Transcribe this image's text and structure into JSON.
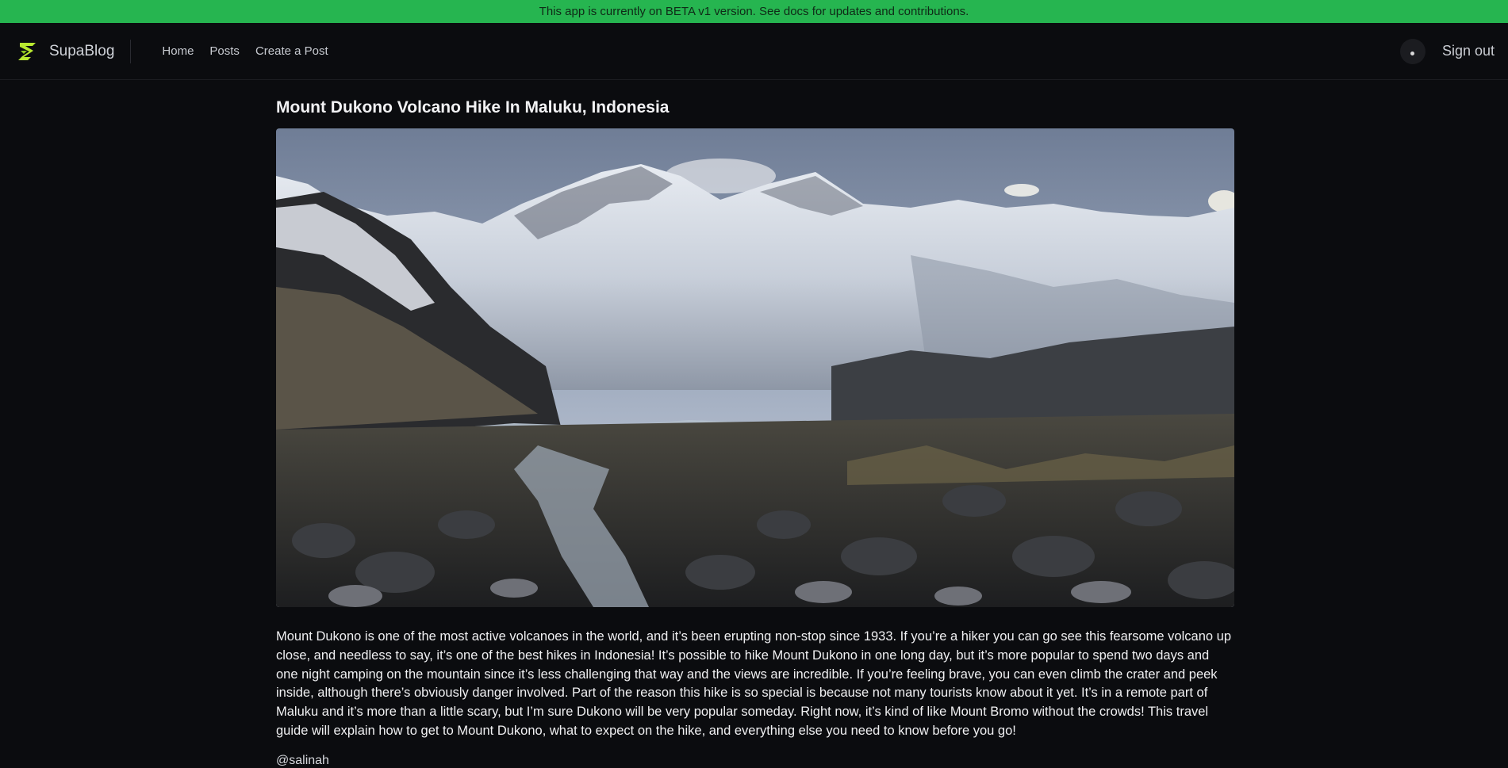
{
  "banner": {
    "text": "This app is currently on BETA v1 version. See docs for updates and contributions."
  },
  "nav": {
    "brand": "SupaBlog",
    "links": [
      {
        "label": "Home"
      },
      {
        "label": "Posts"
      },
      {
        "label": "Create a Post"
      }
    ],
    "signout_label": "Sign out"
  },
  "post": {
    "title": "Mount Dukono Volcano Hike In Maluku, Indonesia",
    "image_icon": "snowy-mountain-landscape-photo",
    "body": "Mount Dukono is one of the most active volcanoes in the world, and it’s been erupting non-stop since 1933. If you’re a hiker you can go see this fearsome volcano up close, and needless to say, it’s one of the best hikes in Indonesia! It’s possible to hike Mount Dukono in one long day, but it’s more popular to spend two days and one night camping on the mountain since it’s less challenging that way and the views are incredible. If you’re feeling brave, you can even climb the crater and peek inside, although there’s obviously danger involved. Part of the reason this hike is so special is because not many tourists know about it yet. It’s in a remote part of Maluku and it’s more than a little scary, but I’m sure Dukono will be very popular someday. Right now, it’s kind of like Mount Bromo without the crowds! This travel guide will explain how to get to Mount Dukono, what to expect on the hike, and everything else you need to know before you go!",
    "author": "@salinah"
  },
  "colors": {
    "banner": "#26b550",
    "background": "#0b0c0f",
    "brand_accent": "#b8e830"
  }
}
